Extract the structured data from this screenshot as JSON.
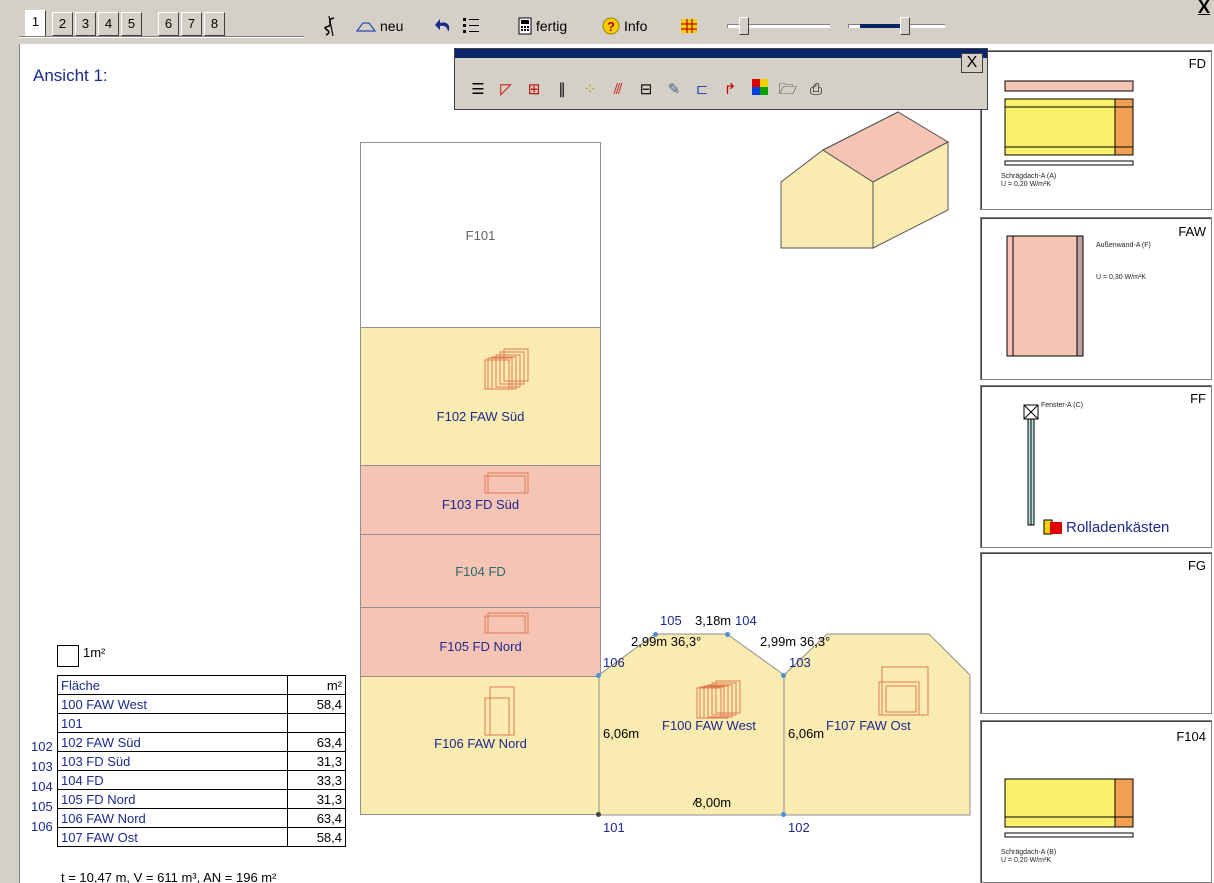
{
  "toolbar": {
    "tabs": [
      "1",
      "2",
      "3",
      "4",
      "5",
      "6",
      "7",
      "8"
    ],
    "new_label": "neu",
    "done_label": "fertig",
    "info_label": "Info",
    "close_symbol": "X"
  },
  "palette": {
    "close_symbol": "X"
  },
  "view": {
    "title": "Ansicht 1:"
  },
  "faces": {
    "f101": "F101",
    "f102": "F102 FAW Süd",
    "f103": "F103 FD Süd",
    "f104": "F104 FD",
    "f105": "F105 FD Nord",
    "f106": "F106 FAW Nord",
    "f100": "F100 FAW West",
    "f107": "F107 FAW Ost"
  },
  "dimensions": {
    "d1": "3,18m",
    "d2": "2,99m 36,3°",
    "d3": "2,99m 36,3°",
    "d4": "6,06m",
    "d5": "6,06m",
    "d6": "8,00m"
  },
  "vertices": {
    "v101": "101",
    "v102": "102",
    "v103": "103",
    "v104": "104",
    "v105": "105",
    "v106": "106"
  },
  "legend": {
    "label": "1m²"
  },
  "table": {
    "header_name": "Fläche",
    "header_unit": "m²",
    "row_labels": [
      "102",
      "103",
      "104",
      "105",
      "106"
    ],
    "rows": [
      {
        "name": "100 FAW West",
        "value": "58,4"
      },
      {
        "name": "101",
        "value": ""
      },
      {
        "name": "102 FAW Süd",
        "value": "63,4"
      },
      {
        "name": "103 FD Süd",
        "value": "31,3"
      },
      {
        "name": "104 FD",
        "value": "33,3"
      },
      {
        "name": "105 FD Nord",
        "value": "31,3"
      },
      {
        "name": "106 FAW Nord",
        "value": "63,4"
      },
      {
        "name": "107 FAW Ost",
        "value": "58,4"
      }
    ]
  },
  "summary": "t = 10,47 m, V = 611 m³, AN = 196 m²",
  "cards": {
    "fd": {
      "code": "FD",
      "line1": "Schrägdach-A (A)",
      "line2": "U = 0,20 W/m²K"
    },
    "faw": {
      "code": "FAW",
      "line1": "Außenwand-A (F)",
      "line2": "U = 0,30 W/m²K"
    },
    "ff": {
      "code": "FF",
      "line1": "Fenster-A (C)",
      "link": "Rolladenkästen"
    },
    "fg": {
      "code": "FG"
    },
    "f104": {
      "code": "F104",
      "line1": "Schrägdach-A (B)",
      "line2": "U = 0,20 W/m²K"
    }
  },
  "colors": {
    "wall": "#faebb0",
    "roof": "#f6c4b4",
    "text_blue": "#1c2a8c",
    "window": "#e07a50"
  }
}
